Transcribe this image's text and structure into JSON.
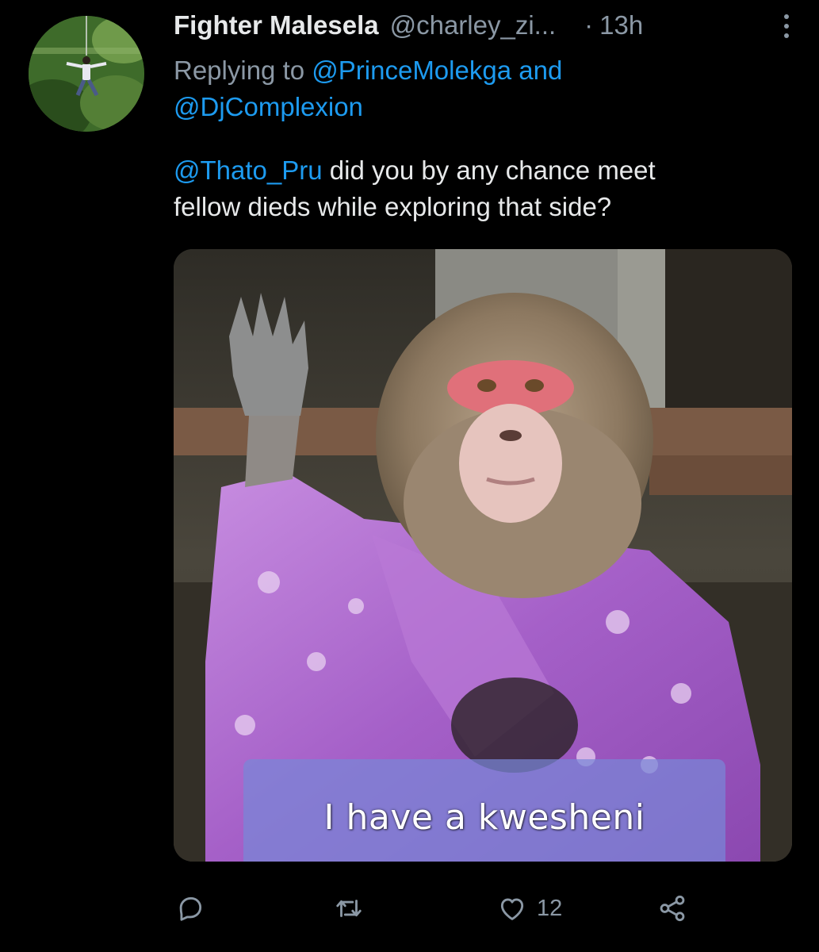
{
  "tweet": {
    "author": {
      "display_name": "Fighter Malesela",
      "handle": "@charley_zi...",
      "avatar_icon": "avatar-zipline-photo"
    },
    "separator": "·",
    "time": "13h",
    "more_icon": "more-vertical-icon",
    "replying": {
      "prefix": "Replying to",
      "user1": "@PrinceMolekga",
      "conjunction": "and",
      "user2": "@DjComplexion"
    },
    "body": {
      "mention": "@Thato_Pru",
      "text_line1": "did you by any chance meet",
      "text_line2": "fellow dieds while exploring that side?"
    },
    "media": {
      "caption": "I have a kwesheni",
      "description_icon": "waving-monkey-meme-image"
    },
    "actions": {
      "reply_icon": "reply-icon",
      "retweet_icon": "retweet-icon",
      "like_icon": "like-heart-icon",
      "like_count": "12",
      "share_icon": "share-icon"
    },
    "colors": {
      "background": "#000000",
      "primary_text": "#e7e9ea",
      "secondary_text": "#8b98a5",
      "link": "#1d9bf0"
    }
  }
}
